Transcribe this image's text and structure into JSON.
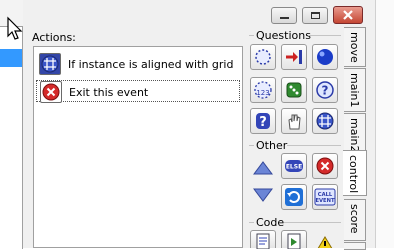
{
  "actions": {
    "label": "Actions:",
    "items": [
      {
        "icon": "grid-icon",
        "text": "If instance is aligned with grid"
      },
      {
        "icon": "exit-icon",
        "text": "Exit this event"
      }
    ]
  },
  "palette": {
    "sections": {
      "questions": "Questions",
      "other": "Other",
      "code": "Code"
    },
    "else_label": "ELSE",
    "call_event_label": "CALL\nEVENT"
  },
  "tabs": [
    "move",
    "main1",
    "main2",
    "control",
    "score"
  ],
  "active_tab": "control"
}
